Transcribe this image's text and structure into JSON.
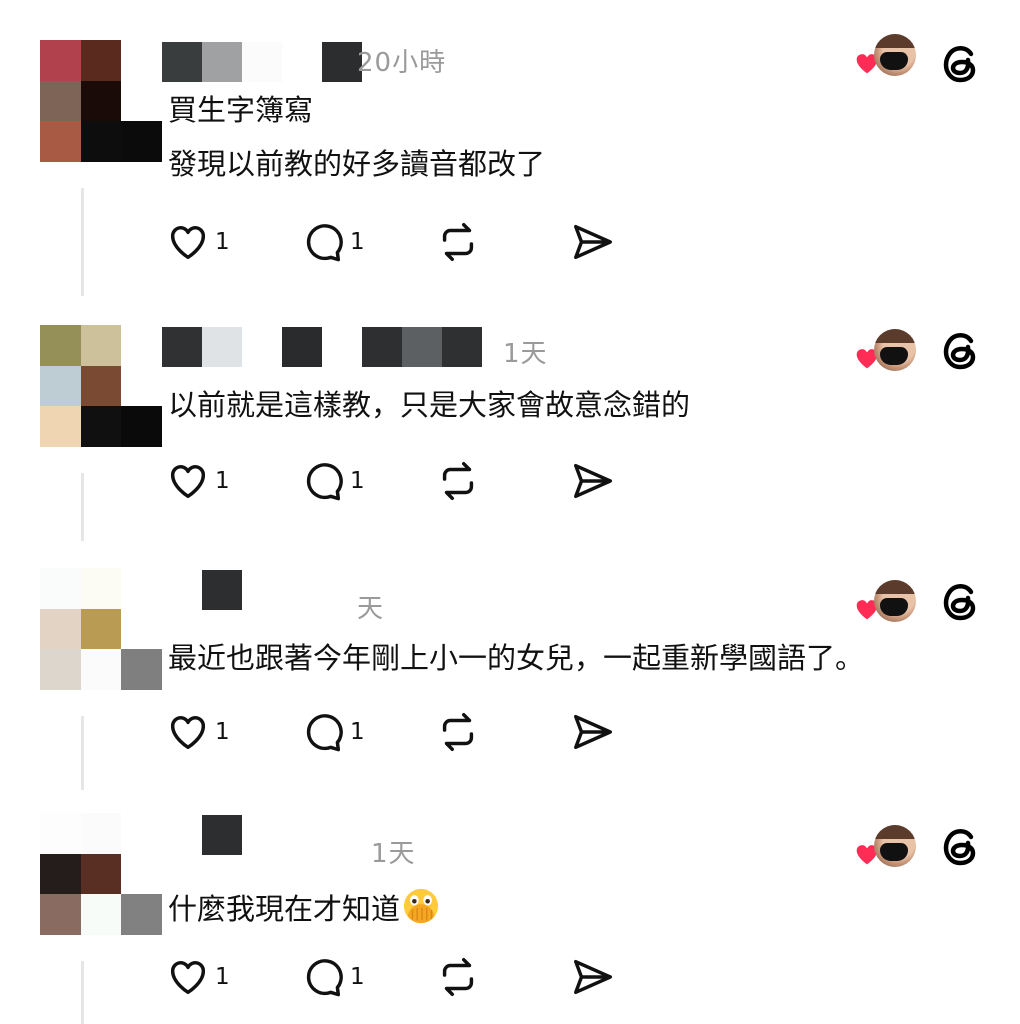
{
  "colors": {
    "accent_heart": "#ff2d55",
    "text": "#111111",
    "muted": "#9a9a9a",
    "thread_line": "#e6e6e6"
  },
  "posts": [
    {
      "timestamp": "20小時",
      "text_lines": [
        "買生字簿寫",
        "發現以前教的好多讀音都改了"
      ],
      "like_count": "1",
      "reply_count": "1",
      "has_emoji": false
    },
    {
      "timestamp": "1天",
      "text_lines": [
        "以前就是這樣教，只是大家會故意念錯的"
      ],
      "like_count": "1",
      "reply_count": "1",
      "has_emoji": false
    },
    {
      "timestamp": "天",
      "text_lines": [
        "最近也跟著今年剛上小一的女兒，一起重新學國語了。"
      ],
      "like_count": "1",
      "reply_count": "1",
      "has_emoji": false
    },
    {
      "timestamp": "1天",
      "text_lines": [
        "什麼我現在才知道"
      ],
      "like_count": "1",
      "reply_count": "1",
      "has_emoji": true,
      "emoji_name": "face-with-open-eyes-and-hand-over-mouth"
    }
  ],
  "icons": {
    "like": "heart-outline-icon",
    "reply": "speech-bubble-icon",
    "repost": "repost-arrows-icon",
    "share": "send-paper-plane-icon",
    "liked_by": "red-heart-icon",
    "app": "threads-logo-icon"
  }
}
